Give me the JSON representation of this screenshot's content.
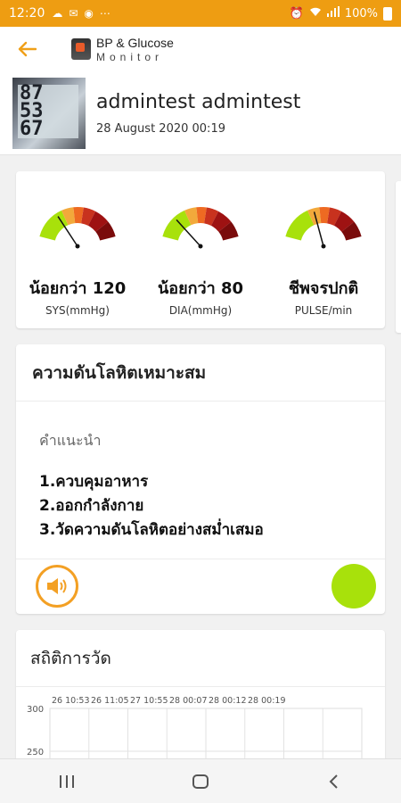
{
  "status_bar": {
    "time": "12:20",
    "battery": "100%",
    "left_icons": [
      "cloud-icon",
      "mail-icon",
      "chrome-icon",
      "more-icon"
    ],
    "right_icons": [
      "alarm-icon",
      "wifi-icon",
      "signal-icon",
      "battery-icon"
    ],
    "color": "#ee9d12"
  },
  "app_bar": {
    "logo_title": "BP & Glucose",
    "logo_subtitle": "Monitor",
    "accent": "#f0a018"
  },
  "header": {
    "user_name": "admintest admintest",
    "date": "28 August 2020 00:19",
    "photo_digits": [
      "87",
      "53",
      "67"
    ]
  },
  "gauges": [
    {
      "value": "น้อยกว่า 120",
      "unit": "SYS(mmHg)",
      "needle_fraction": 0.28
    },
    {
      "value": "น้อยกว่า 80",
      "unit": "DIA(mmHg)",
      "needle_fraction": 0.22
    },
    {
      "value": "ชีพจรปกติ",
      "unit": "PULSE/min",
      "needle_fraction": 0.4
    }
  ],
  "advice": {
    "title": "ความดันโลหิตเหมาะสม",
    "label": "คำแนะนำ",
    "items": [
      "1.ควบคุมอาหาร",
      "2.ออกกำลังกาย",
      "3.วัดความดันโลหิตอย่างสม่ำเสมอ"
    ],
    "status_color": "#a8e10b",
    "speaker_color": "#f3a024"
  },
  "stats": {
    "title": "สถิติการวัด",
    "x_labels": [
      "26 10:53",
      "26 11:05",
      "27 10:55",
      "28 00:07",
      "28 00:12",
      "28 00:19"
    ],
    "y_labels": [
      "300",
      "250"
    ]
  }
}
